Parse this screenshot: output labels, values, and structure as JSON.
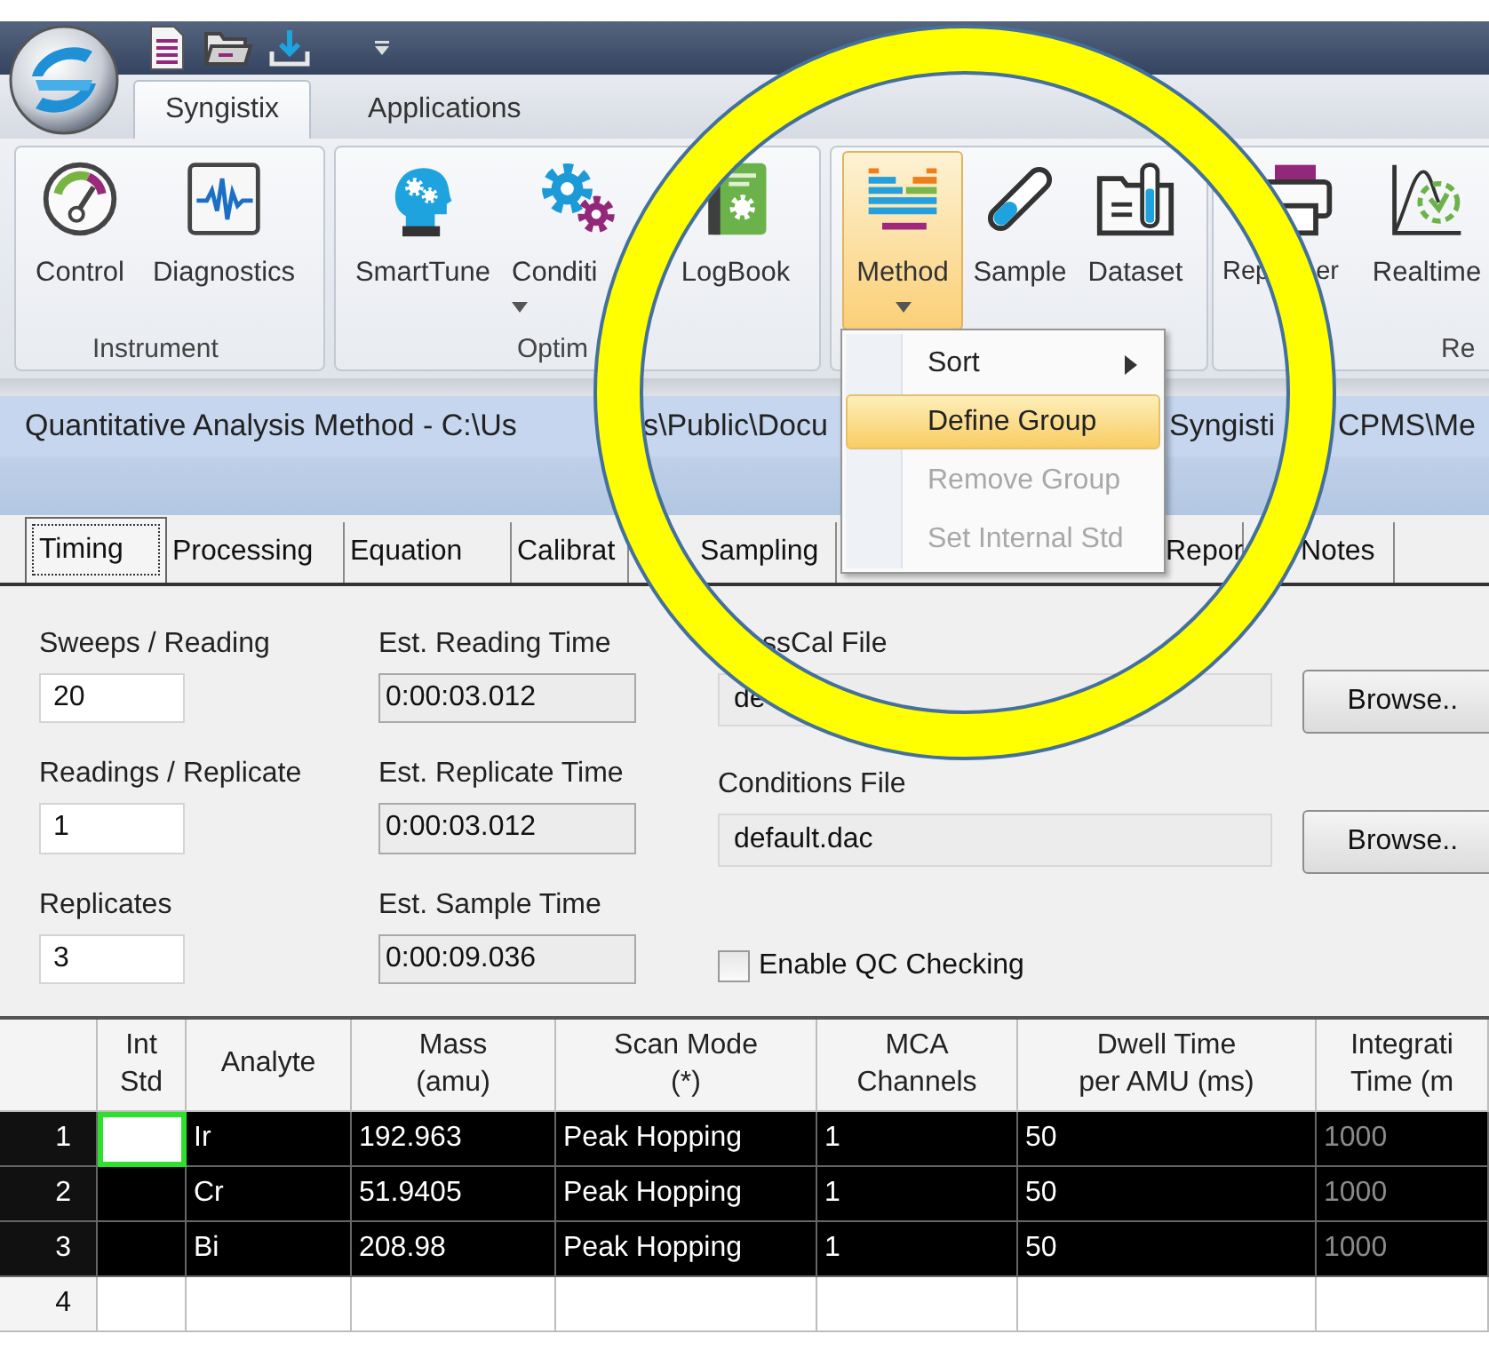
{
  "ribbon_tabs": [
    {
      "label": "Syngistix",
      "selected": true
    },
    {
      "label": "Applications",
      "selected": false
    }
  ],
  "ribbon_groups": [
    {
      "label": "Instrument",
      "buttons": [
        {
          "label": "Control",
          "dropdown": false,
          "pressed": false
        },
        {
          "label": "Diagnostics",
          "dropdown": false,
          "pressed": false
        }
      ]
    },
    {
      "label": "Optim",
      "buttons": [
        {
          "label": "SmartTune",
          "dropdown": false,
          "pressed": false
        },
        {
          "label": "Conditi",
          "dropdown": true,
          "pressed": false
        },
        {
          "label": "LogBook",
          "dropdown": false,
          "pressed": false
        }
      ]
    },
    {
      "buttons": [
        {
          "label": "Method",
          "dropdown": true,
          "pressed": true
        },
        {
          "label": "Sample",
          "dropdown": false,
          "pressed": false
        },
        {
          "label": "Dataset",
          "dropdown": false,
          "pressed": false
        }
      ]
    },
    {
      "label": "Re",
      "buttons": [
        {
          "label": "Rep",
          "label_tail": "er",
          "dropdown": false,
          "pressed": false
        },
        {
          "label": "Realtime",
          "dropdown": false,
          "pressed": false
        }
      ]
    }
  ],
  "method_menu": [
    {
      "label": "Sort",
      "submenu": true,
      "highlighted": false,
      "disabled": false
    },
    {
      "label": "Define Group",
      "submenu": false,
      "highlighted": true,
      "disabled": false
    },
    {
      "label": "Remove Group",
      "submenu": false,
      "highlighted": false,
      "disabled": true
    },
    {
      "label": "Set Internal Std",
      "submenu": false,
      "highlighted": false,
      "disabled": true
    }
  ],
  "document": {
    "title_parts": [
      "Quantitative Analysis Method - C:\\Us",
      "s\\Public\\Docu",
      "Syngisti",
      "CPMS\\Me"
    ]
  },
  "method_tabs": [
    {
      "label": "Timing",
      "selected": true
    },
    {
      "label": "Processing",
      "selected": false
    },
    {
      "label": "Equation",
      "selected": false
    },
    {
      "label": "Calibrat",
      "selected": false
    },
    {
      "label": "Sampling",
      "selected": false
    },
    {
      "label": "Repor",
      "selected": false
    },
    {
      "label": "Notes",
      "selected": false
    }
  ],
  "timing": {
    "columns": [
      [
        {
          "label": "Sweeps / Reading",
          "value": "20",
          "readonly": false
        },
        {
          "label": "Readings / Replicate",
          "value": "1",
          "readonly": false
        },
        {
          "label": "Replicates",
          "value": "3",
          "readonly": false
        }
      ],
      [
        {
          "label": "Est. Reading Time",
          "value": "0:00:03.012",
          "readonly": true
        },
        {
          "label": "Est. Replicate Time",
          "value": "0:00:03.012",
          "readonly": true
        },
        {
          "label": "Est. Sample Time",
          "value": "0:00:09.036",
          "readonly": true
        }
      ]
    ],
    "files": [
      {
        "label": "ssCal File",
        "value": "de",
        "button": "Browse.."
      },
      {
        "label": "Conditions File",
        "value": "default.dac",
        "button": "Browse.."
      }
    ],
    "qc_checkbox": {
      "label": "Enable QC Checking",
      "checked": false
    }
  },
  "analyte_table": {
    "columns": [
      {
        "lines": [
          "Int",
          "Std"
        ]
      },
      {
        "lines": [
          "Analyte"
        ],
        "readonly": false
      },
      {
        "lines": [
          "Mass",
          "(amu)"
        ],
        "readonly": false
      },
      {
        "lines": [
          "Scan Mode",
          "(*)"
        ],
        "readonly": false
      },
      {
        "lines": [
          "MCA",
          "Channels"
        ],
        "readonly": false
      },
      {
        "lines": [
          "Dwell Time",
          "per AMU (ms)"
        ],
        "readonly": false
      },
      {
        "lines": [
          "Integrati",
          "Time (m"
        ],
        "readonly": true
      }
    ],
    "rows": [
      {
        "number": "1",
        "selected": true,
        "focused_int_std": true,
        "cells": [
          "Ir",
          "192.963",
          "Peak Hopping",
          "1",
          "50",
          "1000"
        ]
      },
      {
        "number": "2",
        "selected": true,
        "focused_int_std": false,
        "cells": [
          "Cr",
          "51.9405",
          "Peak Hopping",
          "1",
          "50",
          "1000"
        ]
      },
      {
        "number": "3",
        "selected": true,
        "focused_int_std": false,
        "cells": [
          "Bi",
          "208.98",
          "Peak Hopping",
          "1",
          "50",
          "1000"
        ]
      },
      {
        "number": "4",
        "selected": false,
        "focused_int_std": false
      }
    ]
  }
}
